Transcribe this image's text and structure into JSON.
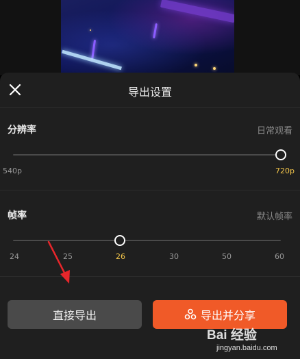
{
  "dialog": {
    "title": "导出设置"
  },
  "resolution": {
    "label": "分辨率",
    "hint": "日常观看",
    "min_label": "540p",
    "max_label": "720p",
    "selected": "720p"
  },
  "frame_rate": {
    "label": "帧率",
    "hint": "默认帧率",
    "ticks": [
      "24",
      "25",
      "26",
      "30",
      "50",
      "60"
    ],
    "selected": "26"
  },
  "buttons": {
    "direct_export": "直接导出",
    "export_and_share": "导出并分享"
  },
  "watermark": {
    "brand": "Bai  经验",
    "url": "jingyan.baidu.com"
  },
  "colors": {
    "accent": "#f05a28",
    "selected_tick": "#f5c74b",
    "annotation_arrow": "#e8262b"
  }
}
